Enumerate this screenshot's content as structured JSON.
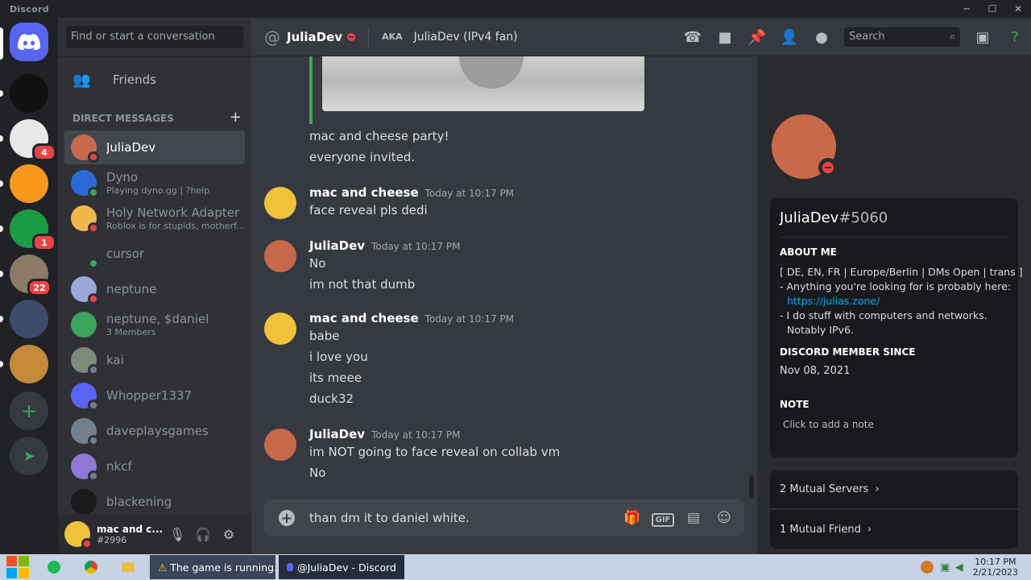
{
  "window": {
    "title": "Discord"
  },
  "servers": [
    {
      "name": "dark-server",
      "bg": "#111111",
      "badge": ""
    },
    {
      "name": "family-guy",
      "bg": "#e8e8e8",
      "badge": "4"
    },
    {
      "name": "hub",
      "bg": "#f7971c",
      "badge": ""
    },
    {
      "name": "green-m",
      "bg": "#1a9c45",
      "badge": "1"
    },
    {
      "name": "cartoon",
      "bg": "#8a7a66",
      "badge": "22"
    },
    {
      "name": "politician",
      "bg": "#3c4a6b",
      "badge": ""
    },
    {
      "name": "burger",
      "bg": "#c48a3a",
      "badge": ""
    }
  ],
  "dm_sidebar": {
    "search_placeholder": "Find or start a conversation",
    "friends_label": "Friends",
    "section_label": "DIRECT MESSAGES",
    "items": [
      {
        "name": "JuliaDev",
        "sub": "",
        "color": "#c9694b",
        "status": "#ed4245",
        "active": true
      },
      {
        "name": "Dyno",
        "sub": "Playing dyno.gg | ?help",
        "color": "#2b6ad6",
        "status": "#3ba55d"
      },
      {
        "name": "Holy Network Adapter",
        "sub": "Roblox is for stupids, motherf...",
        "color": "#f0b84a",
        "status": "#ed4245"
      },
      {
        "name": "cursor",
        "sub": "",
        "color": "#2f3136",
        "status": "#3ba55d"
      },
      {
        "name": "neptune",
        "sub": "",
        "color": "#9aa7d8",
        "status": "#ed4245"
      },
      {
        "name": "neptune, $daniel",
        "sub": "3 Members",
        "color": "#3ba55d",
        "status": ""
      },
      {
        "name": "kai",
        "sub": "",
        "color": "#7c8a7a",
        "status": "#747f8d"
      },
      {
        "name": "Whopper1337",
        "sub": "",
        "color": "#5865f2",
        "status": "#747f8d"
      },
      {
        "name": "daveplaysgames",
        "sub": "",
        "color": "#747f8d",
        "status": "#747f8d"
      },
      {
        "name": "nkcf",
        "sub": "",
        "color": "#8e7ad6",
        "status": "#747f8d"
      },
      {
        "name": "blackening",
        "sub": "",
        "color": "#1a1a1a",
        "status": ""
      }
    ]
  },
  "user": {
    "name": "mac and c...",
    "tag": "#2996"
  },
  "header": {
    "name": "JuliaDev",
    "aka_label": "AKA",
    "aka": "JuliaDev (IPv4 fan)",
    "search_placeholder": "Search"
  },
  "chat": {
    "lines": [
      {
        "text": "mac and cheese party!"
      },
      {
        "text": "everyone invited."
      }
    ],
    "messages": [
      {
        "author": "mac and cheese",
        "time": "Today at 10:17 PM",
        "avatar": "#f0c23a",
        "lines": [
          "face reveal pls dedi"
        ]
      },
      {
        "author": "JuliaDev",
        "time": "Today at 10:17 PM",
        "avatar": "#c9694b",
        "lines": [
          "No",
          "im not that dumb"
        ]
      },
      {
        "author": "mac and cheese",
        "time": "Today at 10:17 PM",
        "avatar": "#f0c23a",
        "lines": [
          "babe",
          "i love you",
          "its meee",
          "duck32"
        ]
      },
      {
        "author": "JuliaDev",
        "time": "Today at 10:17 PM",
        "avatar": "#c9694b",
        "lines": [
          "im NOT going to face reveal on collab vm",
          "No"
        ]
      }
    ],
    "composer_text": "than dm it to daniel white."
  },
  "profile": {
    "username": "JuliaDev",
    "discriminator": "#5060",
    "about_label": "ABOUT ME",
    "about_lines": [
      "[ DE, EN, FR | Europe/Berlin | DMs Open | trans ]",
      "- Anything you're looking for is probably here:",
      "https://julias.zone/",
      "- I do stuff with computers and networks.",
      "Notably IPv6."
    ],
    "member_since_label": "DISCORD MEMBER SINCE",
    "member_since": "Nov 08, 2021",
    "note_label": "NOTE",
    "note_placeholder": "Click to add a note",
    "mutual_servers": "2 Mutual Servers",
    "mutual_friends": "1 Mutual Friend"
  },
  "taskbar": {
    "tasks": [
      "The game is running...",
      "@JuliaDev - Discord"
    ],
    "time": "10:17 PM",
    "date": "2/21/2023"
  }
}
